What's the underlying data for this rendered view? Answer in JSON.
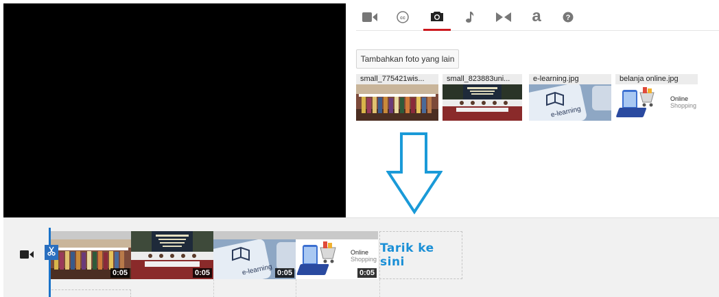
{
  "toolbar": {
    "tools": [
      {
        "icon": "video-camera-icon"
      },
      {
        "icon": "closed-caption-icon",
        "glyph": "cc"
      },
      {
        "icon": "photo-camera-icon",
        "active": true
      },
      {
        "icon": "music-note-icon"
      },
      {
        "icon": "transitions-icon"
      },
      {
        "icon": "text-a-icon",
        "glyph": "a"
      },
      {
        "icon": "help-icon"
      }
    ],
    "active_color": "#cc181e"
  },
  "photos": {
    "add_button_label": "Tambahkan foto yang lain",
    "items": [
      {
        "filename": "small_775421wis..."
      },
      {
        "filename": "small_823883uni..."
      },
      {
        "filename": "e-learning.jpg"
      },
      {
        "filename": "belanja online.jpg"
      }
    ]
  },
  "timeline": {
    "clips": [
      {
        "duration": "0:05"
      },
      {
        "duration": "0:05"
      },
      {
        "duration": "0:05"
      },
      {
        "duration": "0:05"
      }
    ],
    "dropzone_text": "Tarik ke sini",
    "accent_color": "#1a8fd6"
  },
  "elearning_label": "e-learning",
  "online_shopping_label": [
    "Online",
    "Shopping"
  ]
}
